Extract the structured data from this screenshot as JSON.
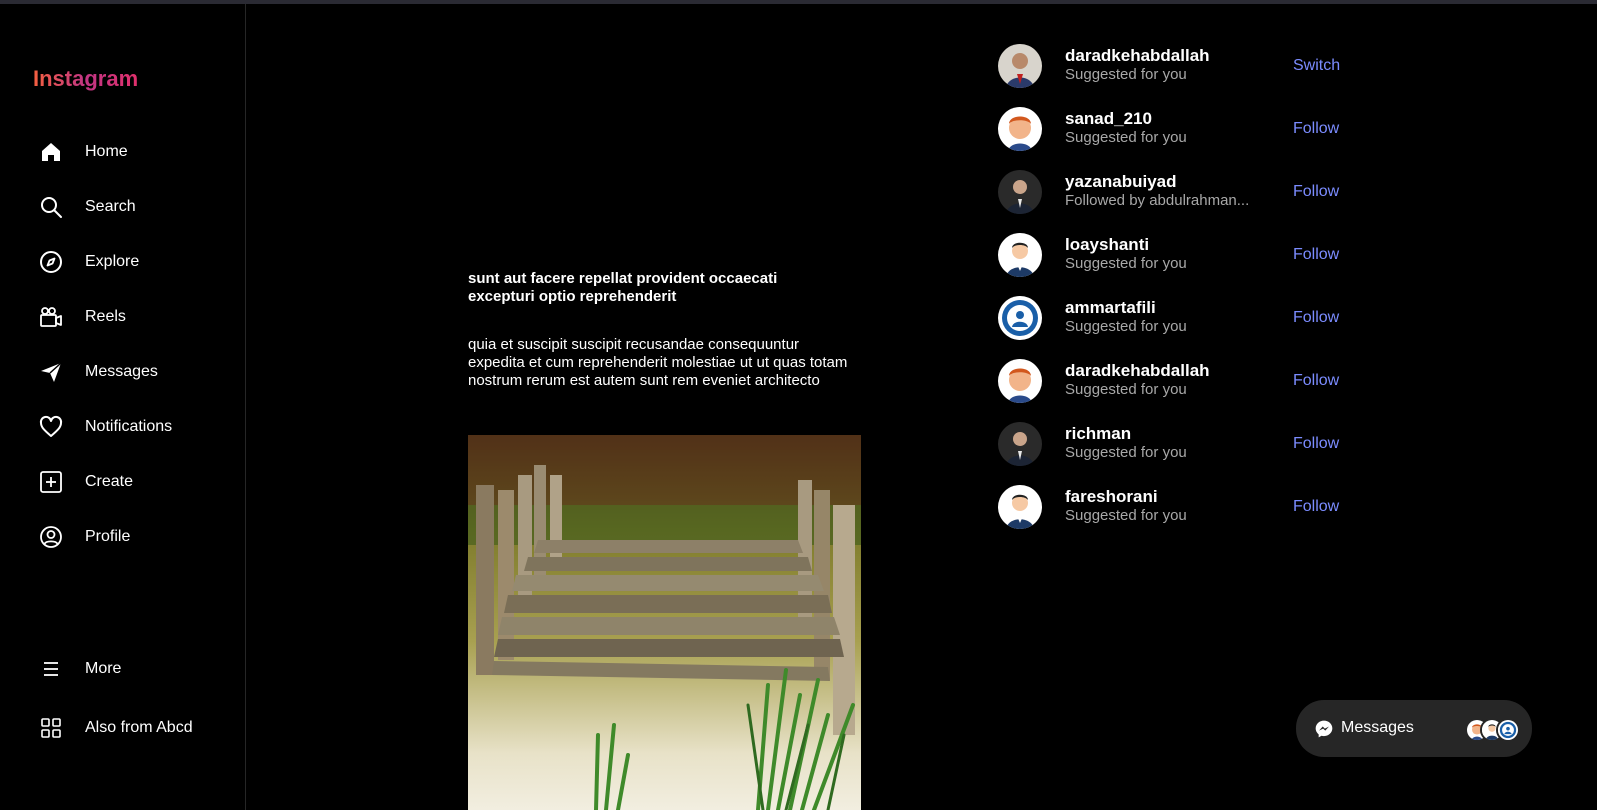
{
  "app": {
    "logo": "Instagram"
  },
  "sidebar": {
    "items": [
      {
        "label": "Home",
        "icon": "home-icon"
      },
      {
        "label": "Search",
        "icon": "search-icon"
      },
      {
        "label": "Explore",
        "icon": "compass-icon"
      },
      {
        "label": "Reels",
        "icon": "reels-icon"
      },
      {
        "label": "Messages",
        "icon": "send-icon"
      },
      {
        "label": "Notifications",
        "icon": "heart-icon"
      },
      {
        "label": "Create",
        "icon": "plus-square-icon"
      },
      {
        "label": "Profile",
        "icon": "user-circle-icon"
      }
    ],
    "more": {
      "label": "More",
      "icon": "menu-icon"
    },
    "also": {
      "label": "Also from Abcd",
      "icon": "grid-icon"
    }
  },
  "post": {
    "title": "sunt aut facere repellat provident occaecati excepturi optio reprehenderit",
    "body": "quia et suscipit suscipit recusandae consequuntur expedita et cum reprehenderit molestiae ut ut quas totam nostrum rerum est autem sunt rem eveniet architecto"
  },
  "suggestions": [
    {
      "username": "daradkehabdallah",
      "subtitle": "Suggested for you",
      "action": "Switch"
    },
    {
      "username": "sanad_210",
      "subtitle": "Suggested for you",
      "action": "Follow"
    },
    {
      "username": "yazanabuiyad",
      "subtitle": "Followed by abdulrahman...",
      "action": "Follow"
    },
    {
      "username": "loayshanti",
      "subtitle": "Suggested for you",
      "action": "Follow"
    },
    {
      "username": "ammartafili",
      "subtitle": "Suggested for you",
      "action": "Follow"
    },
    {
      "username": "daradkehabdallah",
      "subtitle": "Suggested for you",
      "action": "Follow"
    },
    {
      "username": "richman",
      "subtitle": "Suggested for you",
      "action": "Follow"
    },
    {
      "username": "fareshorani",
      "subtitle": "Suggested for you",
      "action": "Follow"
    }
  ],
  "messages_bar": {
    "label": "Messages",
    "icon": "messenger-icon"
  },
  "colors": {
    "accent_link": "#7b8cff",
    "background": "#000000",
    "panel": "#262626"
  }
}
